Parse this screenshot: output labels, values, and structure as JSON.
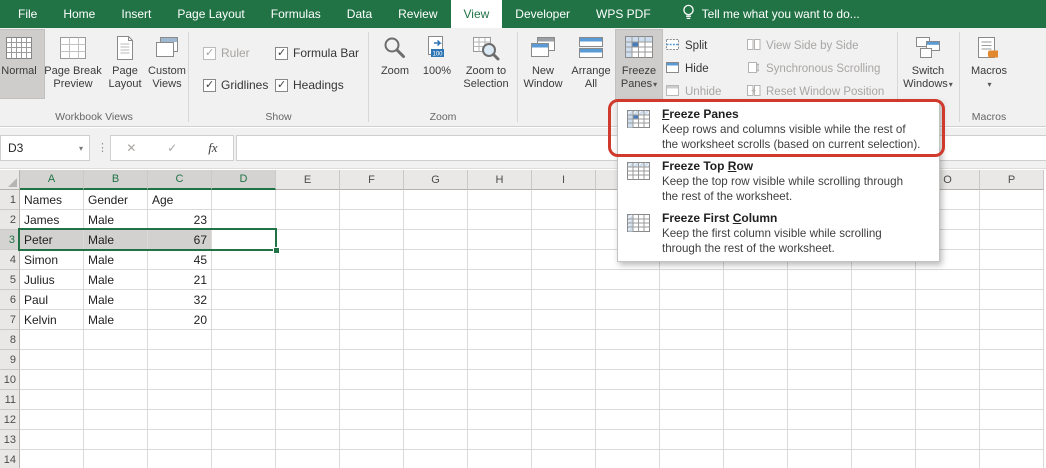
{
  "tabs": [
    {
      "label": "File"
    },
    {
      "label": "Home"
    },
    {
      "label": "Insert"
    },
    {
      "label": "Page Layout"
    },
    {
      "label": "Formulas"
    },
    {
      "label": "Data"
    },
    {
      "label": "Review"
    },
    {
      "label": "View",
      "active": true
    },
    {
      "label": "Developer"
    },
    {
      "label": "WPS PDF"
    }
  ],
  "tell_me": "Tell me what you want to do...",
  "ribbon": {
    "workbook_views": {
      "group_label": "Workbook Views",
      "normal": {
        "label": "Normal"
      },
      "page_break_preview": {
        "lines": [
          "Page Break",
          "Preview"
        ]
      },
      "page_layout": {
        "lines": [
          "Page",
          "Layout"
        ]
      },
      "custom_views": {
        "lines": [
          "Custom",
          "Views"
        ]
      }
    },
    "show": {
      "group_label": "Show",
      "checkboxes": [
        {
          "label": "Ruler",
          "checked": true,
          "disabled": true
        },
        {
          "label": "Formula Bar",
          "checked": true,
          "disabled": false
        },
        {
          "label": "Gridlines",
          "checked": true,
          "disabled": false
        },
        {
          "label": "Headings",
          "checked": true,
          "disabled": false
        }
      ]
    },
    "zoom": {
      "group_label": "Zoom",
      "zoom": {
        "label": "Zoom"
      },
      "pct": {
        "label": "100%"
      },
      "zoom_to_selection": {
        "lines": [
          "Zoom to",
          "Selection"
        ]
      }
    },
    "window": {
      "new_window": {
        "lines": [
          "New",
          "Window"
        ]
      },
      "arrange_all": {
        "lines": [
          "Arrange",
          "All"
        ]
      },
      "freeze_panes": {
        "lines": [
          "Freeze",
          "Panes"
        ],
        "pressed": true
      },
      "split": "Split",
      "hide": "Hide",
      "unhide": "Unhide",
      "view_side_by_side": "View Side by Side",
      "synchronous_scrolling": "Synchronous Scrolling",
      "reset_window_position": "Reset Window Position",
      "switch_windows": {
        "lines": [
          "Switch",
          "Windows"
        ]
      }
    },
    "macros": {
      "group_label": "Macros",
      "macros": {
        "label": "Macros"
      }
    }
  },
  "formula_bar": {
    "name_box": "D3",
    "fx": "fx"
  },
  "sheet": {
    "columns": [
      "A",
      "B",
      "C",
      "D",
      "E",
      "F",
      "G",
      "H",
      "I",
      "J",
      "K",
      "L",
      "M",
      "N",
      "O",
      "P"
    ],
    "visible_rows": 14,
    "selected_columns": [
      "A",
      "B",
      "C",
      "D"
    ],
    "selected_row": 3,
    "selection": {
      "range": "A3:D3",
      "active_cell": "D3",
      "filled": [
        "A3",
        "B3",
        "C3"
      ]
    },
    "cells": [
      [
        "Names",
        "Gender",
        "Age"
      ],
      [
        "James",
        "Male",
        23
      ],
      [
        "Peter",
        "Male",
        67
      ],
      [
        "Simon",
        "Male",
        45
      ],
      [
        "Julius",
        "Male",
        21
      ],
      [
        "Paul",
        "Male",
        32
      ],
      [
        "Kelvin",
        "Male",
        20
      ]
    ]
  },
  "freeze_menu": {
    "items": [
      {
        "title": "Freeze Panes",
        "underline_index": 0,
        "icon": "freeze-panes",
        "annotated": true,
        "desc_lines": [
          "Keep rows and columns visible while the rest of",
          "the worksheet scrolls (based on current selection)."
        ]
      },
      {
        "title": "Freeze Top Row",
        "underline_index": 11,
        "icon": "freeze-top-row",
        "desc_lines": [
          "Keep the top row visible while scrolling through",
          "the rest of the worksheet."
        ]
      },
      {
        "title": "Freeze First Column",
        "underline_index": 13,
        "icon": "freeze-first-column",
        "desc_lines": [
          "Keep the first column visible while scrolling",
          "through the rest of the worksheet."
        ]
      }
    ]
  },
  "annotation": {
    "color": "#cf3a2d"
  }
}
